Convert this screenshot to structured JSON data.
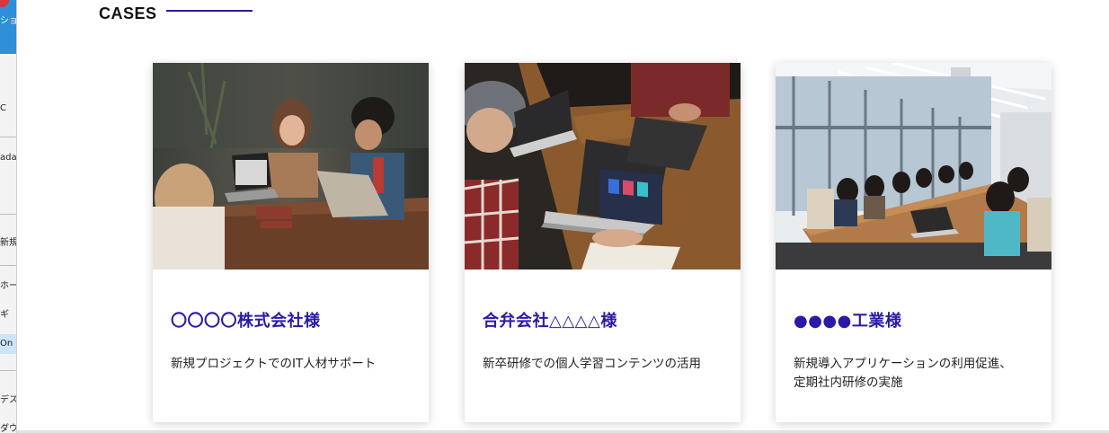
{
  "section": {
    "title": "CASES"
  },
  "os_sidebar": {
    "items": [
      "ショー",
      "C",
      "ada",
      "新規",
      "ホー",
      "ギ",
      "On",
      "デス",
      "ダウ"
    ]
  },
  "cases": [
    {
      "title": "〇〇〇〇株式会社様",
      "description": [
        "新規プロジェクトでのIT人材サポート"
      ],
      "photo": "office-meeting-laptops-photo"
    },
    {
      "title": "合弁会社△△△△様",
      "description": [
        "新卒研修での個人学習コンテンツの活用"
      ],
      "photo": "laptop-discussion-photo"
    },
    {
      "title": "●●●●工業様",
      "description": [
        "新規導入アプリケーションの利用促進、",
        "定期社内研修の実施"
      ],
      "photo": "conference-room-photo"
    }
  ],
  "colors": {
    "accent": "#2a1aa8",
    "text": "#222222"
  }
}
